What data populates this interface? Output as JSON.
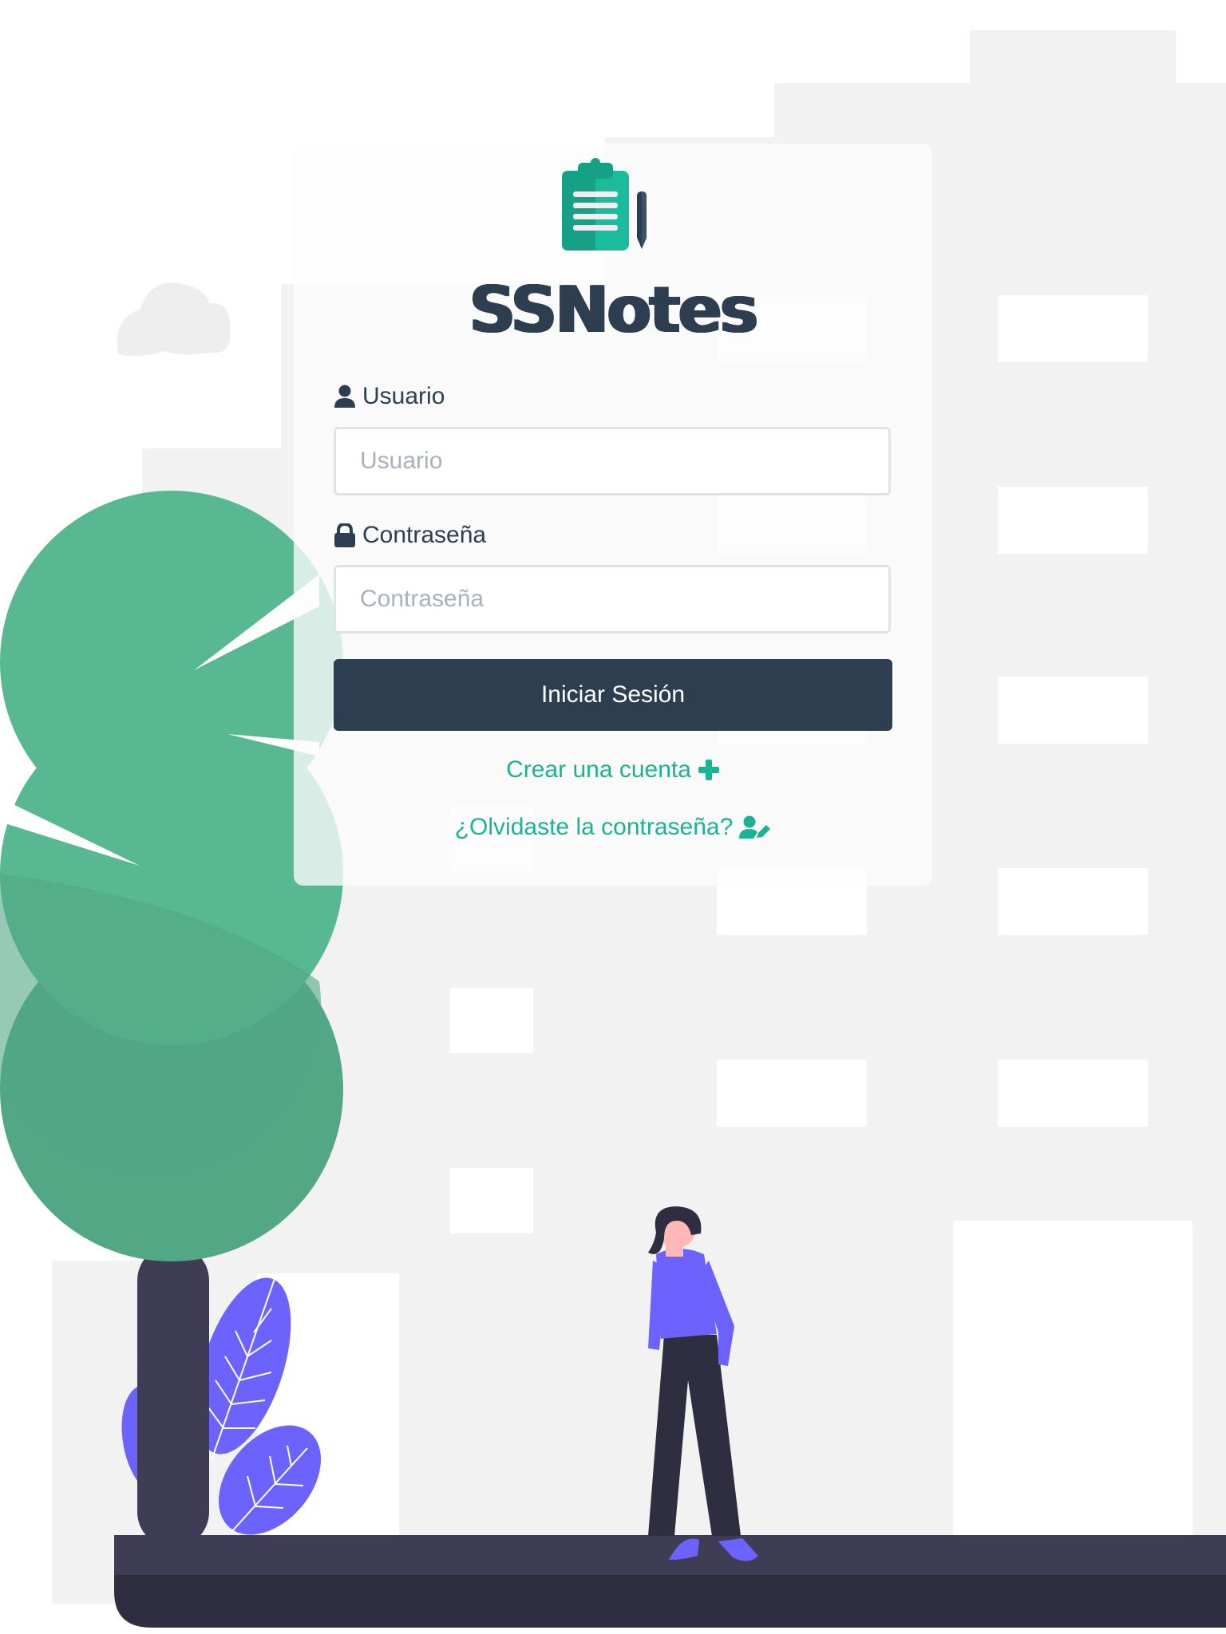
{
  "app": {
    "name": "SSNotes"
  },
  "form": {
    "username_label": "Usuario",
    "username_placeholder": "Usuario",
    "password_label": "Contraseña",
    "password_placeholder": "Contraseña",
    "login_button": "Iniciar Sesión"
  },
  "links": {
    "create_account": "Crear una cuenta",
    "forgot_password": "¿Olvidaste la contraseña?"
  },
  "icons": {
    "logo": "clipboard-pencil-icon",
    "username": "user-icon",
    "password": "lock-icon",
    "create_account": "plus-icon",
    "forgot_password": "user-edit-icon"
  },
  "colors": {
    "primary": "#2d3e50",
    "accent": "#1ab394",
    "tree": "#57b891",
    "plant": "#6c63ff",
    "ground": "#3f3d56"
  }
}
